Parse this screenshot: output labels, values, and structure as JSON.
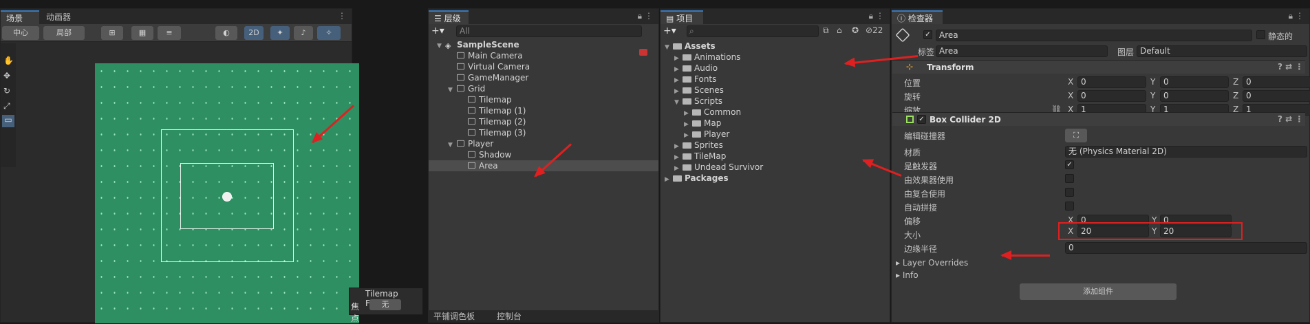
{
  "scene_panel": {
    "tab_scene": "场景",
    "tab_animator": "动画器",
    "pivot": "中心",
    "local": "局部",
    "two_d": "2D",
    "overlay_title": "Tilemap Focus",
    "focus_label": "焦点",
    "focus_value": "无"
  },
  "hierarchy": {
    "tab": "层级",
    "search_placeholder": "All",
    "items": [
      {
        "label": "SampleScene",
        "depth": 0,
        "kind": "scene"
      },
      {
        "label": "Main Camera",
        "depth": 1,
        "kind": "obj"
      },
      {
        "label": "Virtual Camera",
        "depth": 1,
        "kind": "obj"
      },
      {
        "label": "GameManager",
        "depth": 1,
        "kind": "obj"
      },
      {
        "label": "Grid",
        "depth": 1,
        "kind": "obj"
      },
      {
        "label": "Tilemap",
        "depth": 2,
        "kind": "obj"
      },
      {
        "label": "Tilemap (1)",
        "depth": 2,
        "kind": "obj"
      },
      {
        "label": "Tilemap (2)",
        "depth": 2,
        "kind": "obj"
      },
      {
        "label": "Tilemap (3)",
        "depth": 2,
        "kind": "obj"
      },
      {
        "label": "Player",
        "depth": 1,
        "kind": "obj"
      },
      {
        "label": "Shadow",
        "depth": 2,
        "kind": "obj"
      },
      {
        "label": "Area",
        "depth": 2,
        "kind": "obj"
      }
    ],
    "bottom_tab_palette": "平铺调色板",
    "bottom_tab_console": "控制台"
  },
  "project": {
    "tab": "项目",
    "hidden_count": "22",
    "items": [
      {
        "label": "Assets",
        "depth": 0,
        "bold": true
      },
      {
        "label": "Animations",
        "depth": 1
      },
      {
        "label": "Audio",
        "depth": 1
      },
      {
        "label": "Fonts",
        "depth": 1
      },
      {
        "label": "Scenes",
        "depth": 1
      },
      {
        "label": "Scripts",
        "depth": 1
      },
      {
        "label": "Common",
        "depth": 2
      },
      {
        "label": "Map",
        "depth": 2
      },
      {
        "label": "Player",
        "depth": 2
      },
      {
        "label": "Sprites",
        "depth": 1
      },
      {
        "label": "TileMap",
        "depth": 1
      },
      {
        "label": "Undead Survivor",
        "depth": 1
      },
      {
        "label": "Packages",
        "depth": 0,
        "bold": true
      }
    ]
  },
  "inspector": {
    "tab": "检查器",
    "name": "Area",
    "static_label": "静态的",
    "tag_label": "标签",
    "tag_value": "Area",
    "layer_label": "图层",
    "layer_value": "Default",
    "transform": {
      "title": "Transform",
      "position_label": "位置",
      "rotation_label": "旋转",
      "scale_label": "缩放",
      "position": [
        "0",
        "0",
        "0"
      ],
      "rotation": [
        "0",
        "0",
        "0"
      ],
      "scale": [
        "1",
        "1",
        "1"
      ]
    },
    "collider": {
      "title": "Box Collider 2D",
      "edit_label": "编辑碰撞器",
      "material_label": "材质",
      "material_value": "无 (Physics Material 2D)",
      "is_trigger_label": "是触发器",
      "used_by_effector_label": "由效果器使用",
      "used_by_composite_label": "由复合使用",
      "auto_tiling_label": "自动拼接",
      "offset_label": "偏移",
      "offset": [
        "0",
        "0"
      ],
      "size_label": "大小",
      "size": [
        "20",
        "20"
      ],
      "edge_radius_label": "边缘半径",
      "edge_radius": "0",
      "layer_overrides": "Layer Overrides",
      "info": "Info"
    },
    "add_component": "添加组件"
  },
  "axes": {
    "x": "X",
    "y": "Y",
    "z": "Z"
  },
  "colors": {
    "scene_green": "#2e8f62",
    "accent_blue": "#3a79bb",
    "arrow_red": "#e02020"
  }
}
